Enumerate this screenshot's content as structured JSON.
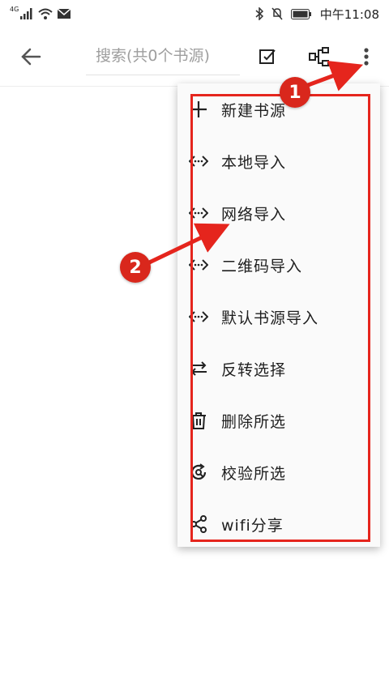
{
  "status": {
    "network": "4G",
    "time": "中午11:08"
  },
  "toolbar": {
    "search_placeholder": "搜索(共0个书源)"
  },
  "menu": {
    "items": [
      {
        "label": "新建书源",
        "icon": "plus-icon"
      },
      {
        "label": "本地导入",
        "icon": "code-brackets-icon"
      },
      {
        "label": "网络导入",
        "icon": "code-brackets-icon"
      },
      {
        "label": "二维码导入",
        "icon": "code-brackets-icon"
      },
      {
        "label": "默认书源导入",
        "icon": "code-brackets-icon"
      },
      {
        "label": "反转选择",
        "icon": "swap-arrows-icon"
      },
      {
        "label": "删除所选",
        "icon": "trash-icon"
      },
      {
        "label": "校验所选",
        "icon": "check-refresh-icon"
      },
      {
        "label": "wifi分享",
        "icon": "share-icon"
      }
    ]
  },
  "annotations": {
    "badge1": "1",
    "badge2": "2"
  },
  "colors": {
    "annotation_red": "#e5251d",
    "menu_bg": "#fafafa"
  }
}
